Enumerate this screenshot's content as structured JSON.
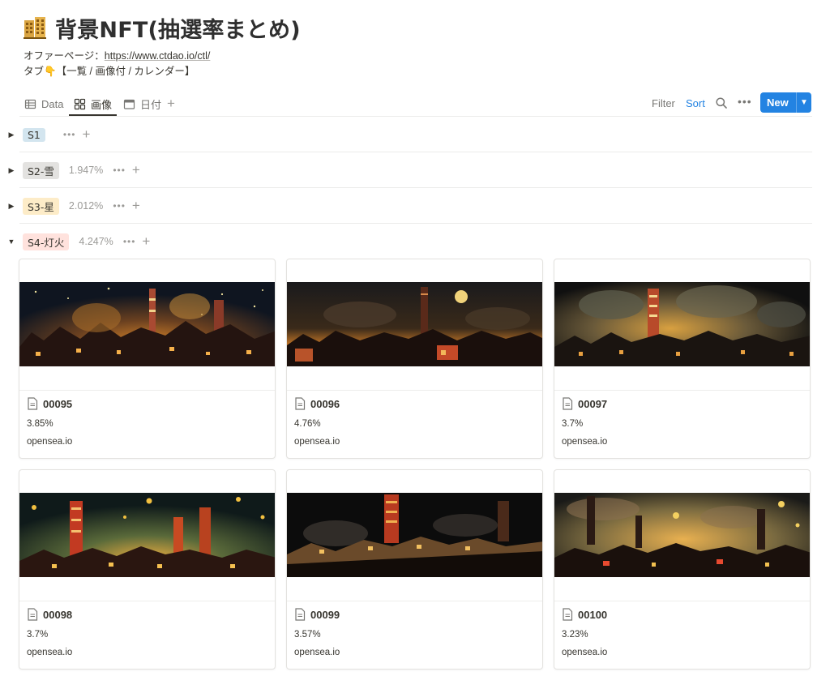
{
  "page": {
    "title": "背景NFT(抽選率まとめ)",
    "icon": "building-icon",
    "desc_prefix": "オファーページ：",
    "desc_link": "https://www.ctdao.io/ctl/",
    "desc_line2": "タブ👇【一覧 / 画像付 / カレンダー】"
  },
  "tabs": [
    {
      "label": "Data",
      "icon": "table-icon"
    },
    {
      "label": "画像",
      "icon": "gallery-icon"
    },
    {
      "label": "日付",
      "icon": "calendar-icon"
    }
  ],
  "toolbar": {
    "filter": "Filter",
    "sort": "Sort",
    "more": "•••",
    "new": "New"
  },
  "groups": [
    {
      "tag": "S1",
      "pct": "",
      "color": "#d3e5ef",
      "expanded": false
    },
    {
      "tag": "S2-雪",
      "pct": "1.947%",
      "color": "#e3e2e0",
      "expanded": false
    },
    {
      "tag": "S3-星",
      "pct": "2.012%",
      "color": "#fdecc8",
      "expanded": false
    },
    {
      "tag": "S4-灯火",
      "pct": "4.247%",
      "color": "#ffe2dd",
      "expanded": true
    }
  ],
  "group_dots": "•••",
  "cards": [
    {
      "name": "00095",
      "pct": "3.85%",
      "site": "opensea.io"
    },
    {
      "name": "00096",
      "pct": "4.76%",
      "site": "opensea.io"
    },
    {
      "name": "00097",
      "pct": "3.7%",
      "site": "opensea.io"
    },
    {
      "name": "00098",
      "pct": "3.7%",
      "site": "opensea.io"
    },
    {
      "name": "00099",
      "pct": "3.57%",
      "site": "opensea.io"
    },
    {
      "name": "00100",
      "pct": "3.23%",
      "site": "opensea.io"
    }
  ],
  "colors": {
    "accent": "#2383e2",
    "text": "#37352f",
    "muted": "#9b9a97"
  }
}
